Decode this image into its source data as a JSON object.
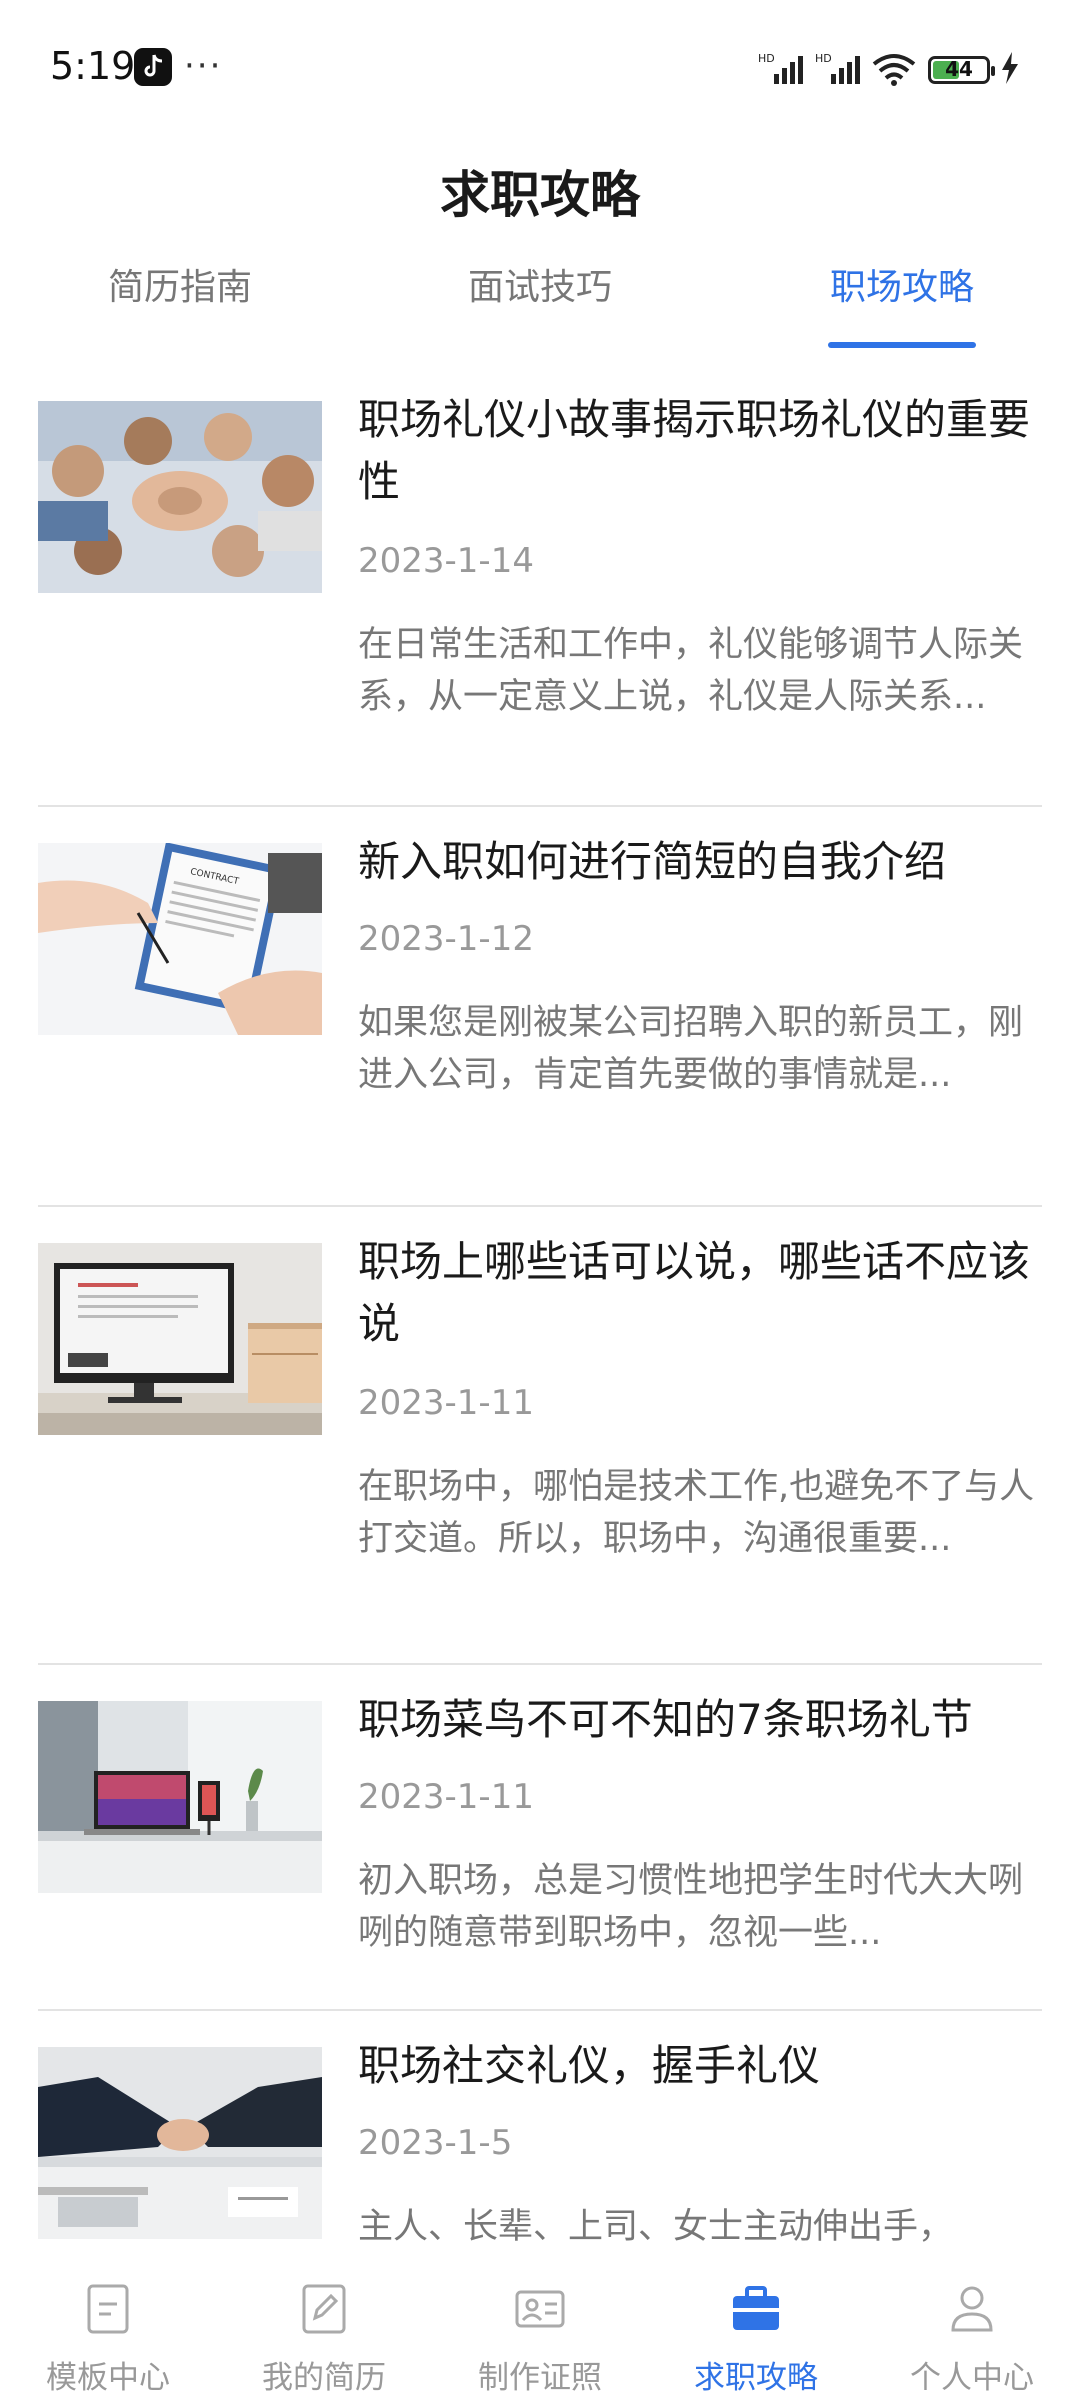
{
  "status_bar": {
    "time": "5:19",
    "dots": "···",
    "battery": "44"
  },
  "header": {
    "title": "求职攻略"
  },
  "tabs": [
    {
      "label": "简历指南",
      "active": false
    },
    {
      "label": "面试技巧",
      "active": false
    },
    {
      "label": "职场攻略",
      "active": true
    }
  ],
  "articles": [
    {
      "title": "职场礼仪小故事揭示职场礼仪的重要性",
      "date": "2023-1-14",
      "summary": "在日常生活和工作中，礼仪能够调节人际关系，从一定意义上说，礼仪是人际关系...",
      "image": "team-hands-photo"
    },
    {
      "title": "新入职如何进行简短的自我介绍",
      "date": "2023-1-12",
      "summary": "如果您是刚被某公司招聘入职的新员工，刚进入公司，肯定首先要做的事情就是...",
      "image": "contract-signing-photo"
    },
    {
      "title": "职场上哪些话可以说，哪些话不应该说",
      "date": "2023-1-11",
      "summary": "在职场中，哪怕是技术工作,也避免不了与人打交道。所以，职场中，沟通很重要...",
      "image": "monitor-desk-photo"
    },
    {
      "title": "职场菜鸟不可不知的7条职场礼节",
      "date": "2023-1-11",
      "summary": "初入职场，总是习惯性地把学生时代大大咧咧的随意带到职场中，忽视一些...",
      "image": "laptop-desk-photo"
    },
    {
      "title": "职场社交礼仪，握手礼仪",
      "date": "2023-1-5",
      "summary": "主人、长辈、上司、女士主动伸出手，",
      "image": "handshake-photo"
    }
  ],
  "bottom_nav": [
    {
      "label": "模板中心",
      "icon": "template-icon",
      "active": false
    },
    {
      "label": "我的简历",
      "icon": "edit-resume-icon",
      "active": false
    },
    {
      "label": "制作证照",
      "icon": "id-card-icon",
      "active": false
    },
    {
      "label": "求职攻略",
      "icon": "briefcase-icon",
      "active": true
    },
    {
      "label": "个人中心",
      "icon": "person-icon",
      "active": false
    }
  ],
  "colors": {
    "accent": "#2f73e6",
    "inactive": "#999999"
  }
}
